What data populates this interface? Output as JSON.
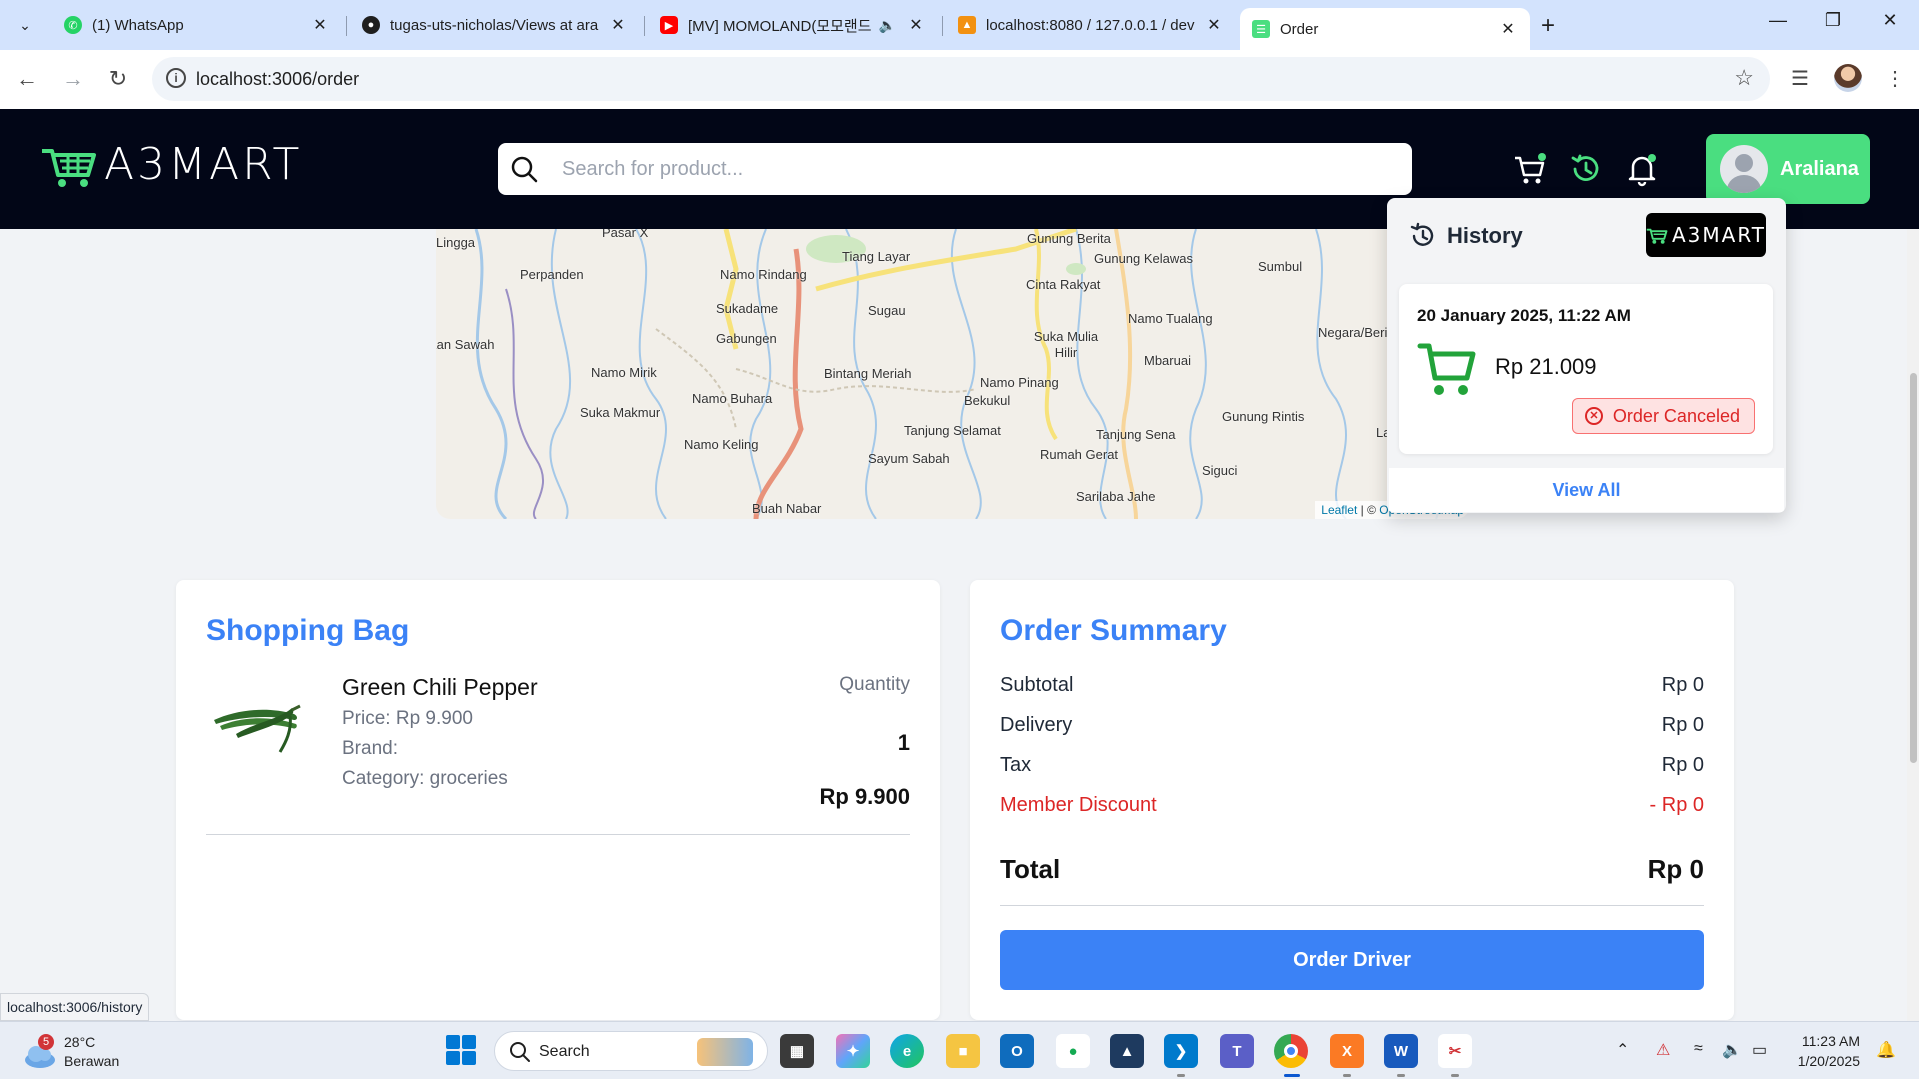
{
  "browser": {
    "tabs": [
      {
        "title": "(1) WhatsApp",
        "icon": "whatsapp-icon"
      },
      {
        "title": "tugas-uts-nicholas/Views at ara",
        "icon": "github-icon"
      },
      {
        "title": "[MV] MOMOLAND(모모랜드",
        "icon": "youtube-icon"
      },
      {
        "title": "localhost:8080 / 127.0.0.1 / dev",
        "icon": "phpmyadmin-icon"
      },
      {
        "title": "Order",
        "icon": "a3mart-icon"
      }
    ],
    "url": "localhost:3006/order",
    "status_url": "localhost:3006/history"
  },
  "header": {
    "logo_text": "A3MART",
    "search_placeholder": "Search for product...",
    "user_name": "Araliana"
  },
  "map": {
    "labels": [
      "Lingga",
      "Pasar X",
      "Perpanden",
      "Namo Rindang",
      "Tiang Layar",
      "Gunung Berita",
      "Gunung Kelawas",
      "Sumbul",
      "Cinta Rakyat",
      "Sukadame",
      "Gabungen",
      "Sugau",
      "Namo Tualang",
      "Negara/Beri",
      "Kan Sawah",
      "Suka Mulia Hilir",
      "Mbaruai",
      "Namo Mirik",
      "Bintang Meriah",
      "Suka Makmur",
      "Namo Buhara",
      "Namo Pinang",
      "Bekukul",
      "Gunung Rintis",
      "Tanjung Selamat",
      "Tanjung Sena",
      "Namo Keling",
      "Sayum Sabah",
      "Rumah Gerat",
      "Siguci",
      "Buah Nabar",
      "Sarilaba Jahe",
      "La"
    ],
    "attribution_leaflet": "Leaflet",
    "attribution_sep": " | © ",
    "attribution_osm": "OpenStreetMap"
  },
  "shopping_bag": {
    "title": "Shopping Bag",
    "item": {
      "name": "Green Chili Pepper",
      "price": "Price: Rp 9.900",
      "brand": "Brand:",
      "category": "Category: groceries",
      "quantity_label": "Quantity",
      "quantity": "1",
      "total": "Rp 9.900"
    }
  },
  "order_summary": {
    "title": "Order Summary",
    "rows": [
      {
        "label": "Subtotal",
        "value": "Rp 0"
      },
      {
        "label": "Delivery",
        "value": "Rp 0"
      },
      {
        "label": "Tax",
        "value": "Rp 0"
      },
      {
        "label": "Member Discount",
        "value": "- Rp 0"
      }
    ],
    "total_label": "Total",
    "total_value": "Rp 0",
    "button": "Order Driver"
  },
  "history": {
    "title": "History",
    "logo_text": "A3MART",
    "entry": {
      "date": "20 January 2025, 11:22 AM",
      "amount": "Rp 21.009",
      "status": "Order Canceled"
    },
    "view_all": "View All"
  },
  "taskbar": {
    "weather_temp": "28°C",
    "weather_cond": "Berawan",
    "weather_badge": "5",
    "search": "Search",
    "time": "11:23 AM",
    "date": "1/20/2025"
  },
  "colors": {
    "accent_blue": "#3b82f6",
    "brand_green": "#4ade80",
    "header_bg": "#020617",
    "danger": "#dc2626"
  }
}
